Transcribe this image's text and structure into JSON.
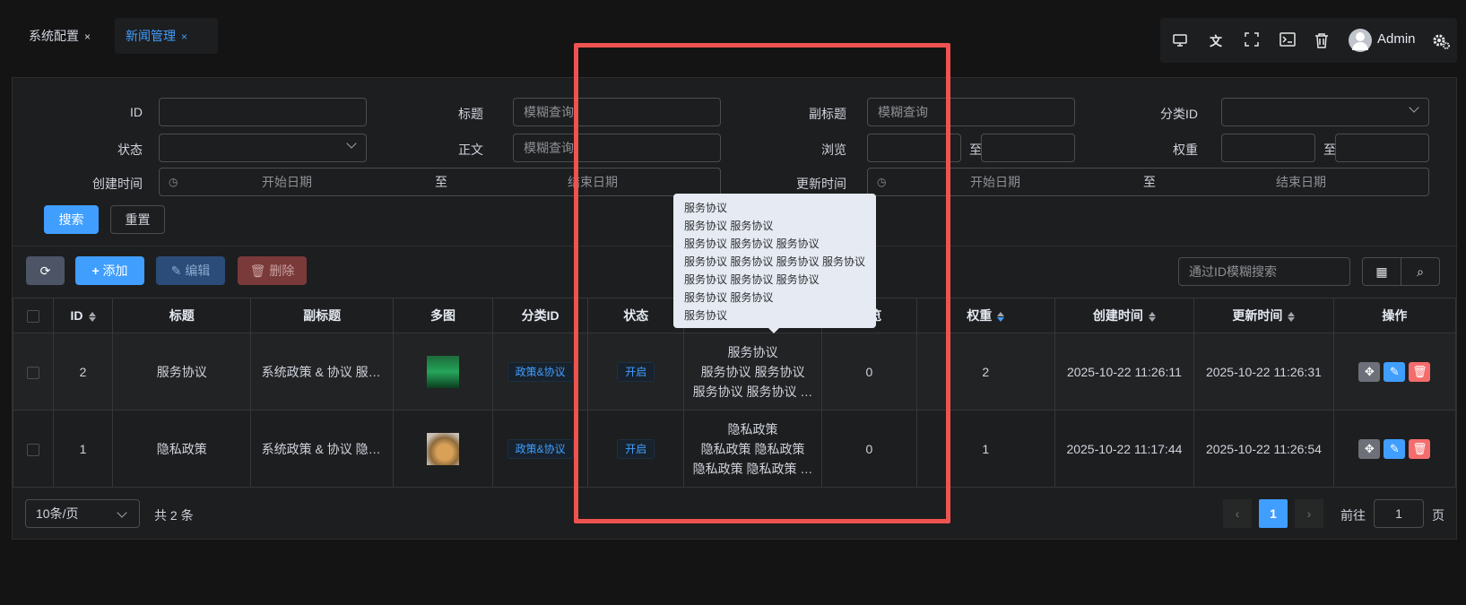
{
  "tabs": [
    {
      "label": "系统配置",
      "close": "×"
    },
    {
      "label": "新闻管理",
      "close": "×"
    }
  ],
  "header": {
    "user": "Admin",
    "icons": [
      "monitor-icon",
      "translate-icon",
      "fullscreen-icon",
      "terminal-icon",
      "trash-icon",
      "settings-icon"
    ]
  },
  "search": {
    "id_label": "ID",
    "title_label": "标题",
    "subtitle_label": "副标题",
    "category_label": "分类ID",
    "status_label": "状态",
    "body_label": "正文",
    "views_label": "浏览",
    "weight_label": "权重",
    "created_label": "创建时间",
    "updated_label": "更新时间",
    "fuzzy": "模糊查询",
    "to": "至",
    "start": "开始日期",
    "end": "结束日期",
    "search_btn": "搜索",
    "reset_btn": "重置"
  },
  "toolbar": {
    "add": "添加",
    "edit": "编辑",
    "delete": "删除",
    "id_search_placeholder": "通过ID模糊搜索"
  },
  "table": {
    "headers": [
      "ID",
      "标题",
      "副标题",
      "多图",
      "分类ID",
      "状态",
      "正文",
      "浏览",
      "权重",
      "创建时间",
      "更新时间",
      "操作"
    ],
    "rows": [
      {
        "id": "2",
        "title": "服务协议",
        "subtitle": "系统政策 & 协议 服务协议",
        "category": "政策&协议",
        "status": "开启",
        "body": [
          "服务协议",
          "服务协议 服务协议",
          "服务协议 服务协议 …"
        ],
        "views": "0",
        "weight": "2",
        "created": "2025-10-22 11:26:11",
        "updated": "2025-10-22 11:26:31"
      },
      {
        "id": "1",
        "title": "隐私政策",
        "subtitle": "系统政策 & 协议 隐私政策",
        "category": "政策&协议",
        "status": "开启",
        "body": [
          "隐私政策",
          "隐私政策 隐私政策",
          "隐私政策 隐私政策 …"
        ],
        "views": "0",
        "weight": "1",
        "created": "2025-10-22 11:17:44",
        "updated": "2025-10-22 11:26:54"
      }
    ]
  },
  "tooltip": {
    "lines": [
      "服务协议",
      "服务协议 服务协议",
      "服务协议 服务协议 服务协议",
      "服务协议 服务协议 服务协议 服务协议",
      "服务协议 服务协议 服务协议",
      "服务协议 服务协议",
      "服务协议"
    ]
  },
  "pagination": {
    "page_size": "10条/页",
    "total": "共 2 条",
    "current": "1",
    "goto_label": "前往",
    "goto_value": "1",
    "page_suffix": "页"
  },
  "colors": {
    "primary": "#409eff",
    "danger": "#f56c6c",
    "highlight": "#ef5350"
  }
}
